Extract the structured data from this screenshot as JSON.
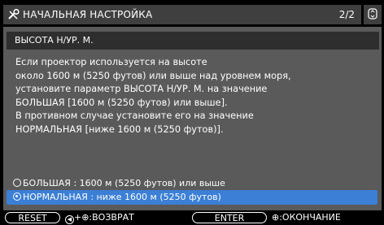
{
  "title": "НАЧАЛЬНАЯ НАСТРОЙКА",
  "page_indicator": "2/2",
  "subheading": "ВЫСОТА Н/УР. М.",
  "description": [
    "Если проектор используется на высоте",
    "около 1600 м (5250 футов) или выше над уровнем моря,",
    "установите  параметр ВЫСОТА Н/УР. М. на значение",
    "БОЛЬШАЯ [1600 м (5250 футов) или выше].",
    "В противном случае установите его на значение",
    "НОРМАЛЬНАЯ [ниже 1600 м (5250 футов)]."
  ],
  "options": [
    {
      "label": "БОЛЬШАЯ      : 1600 м (5250 футов) или выше",
      "selected": false
    },
    {
      "label": "НОРМАЛЬНАЯ : ниже 1600 м (5250 футов)",
      "selected": true
    }
  ],
  "footer": {
    "reset_label": "RESET",
    "back_hint": "+⊕:ВОЗВРАТ",
    "enter_label": "ENTER",
    "finish_hint": "⊕:ОКОНЧАНИЕ"
  },
  "colors": {
    "selected": "#3b7fd6",
    "panel": "#5a5a5a",
    "titlebar": "#3f3f3f"
  },
  "icons": {
    "title": "settings-tools-icon",
    "scroll": "scroll-up-down-icon"
  }
}
